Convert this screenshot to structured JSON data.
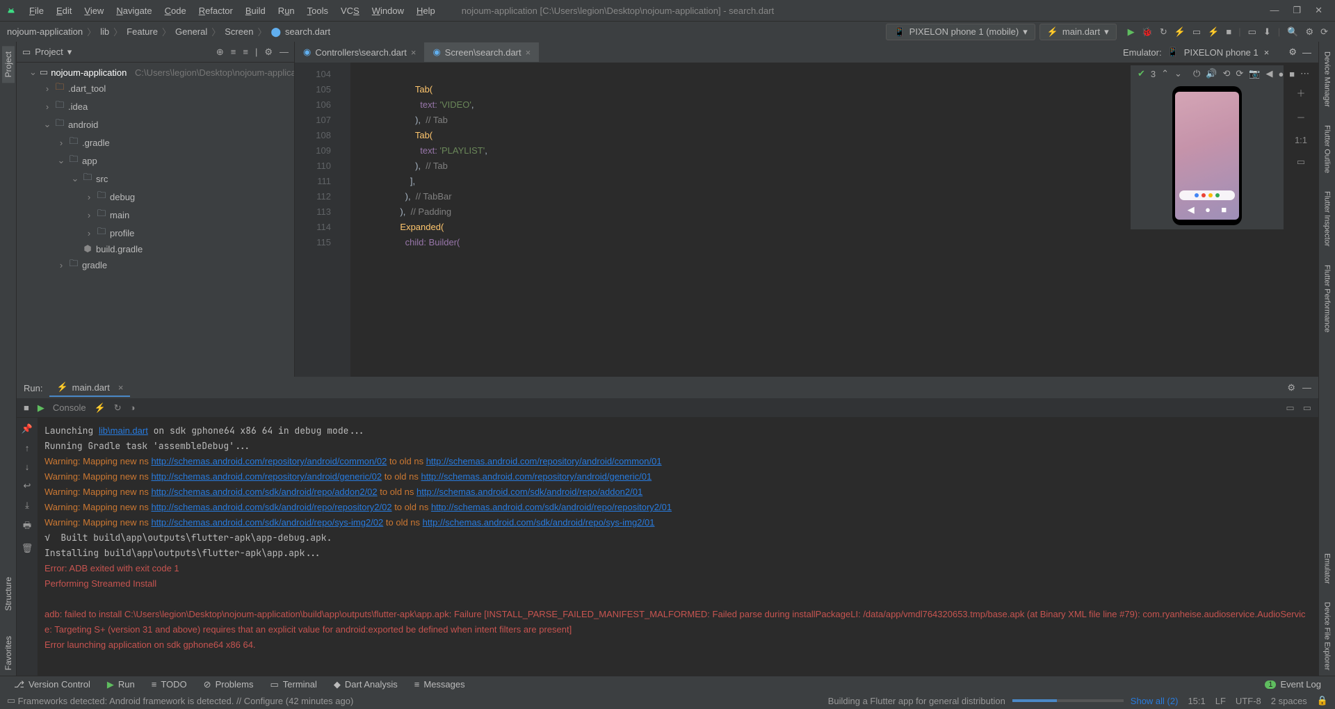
{
  "menu": {
    "file": "File",
    "edit": "Edit",
    "view": "View",
    "navigate": "Navigate",
    "code": "Code",
    "refactor": "Refactor",
    "build": "Build",
    "run": "Run",
    "tools": "Tools",
    "vcs": "VCS",
    "window": "Window",
    "help": "Help"
  },
  "window_title": "nojoum-application [C:\\Users\\legion\\Desktop\\nojoum-application] - search.dart",
  "breadcrumb": [
    "nojoum-application",
    "lib",
    "Feature",
    "General",
    "Screen",
    "search.dart"
  ],
  "device_combo": "PIXELON phone 1 (mobile)",
  "config_combo": "main.dart",
  "left_tools": {
    "project": "Project",
    "structure": "Structure",
    "favorites": "Favorites"
  },
  "right_tools": {
    "device_manager": "Device Manager",
    "flutter_outline": "Flutter Outline",
    "flutter_inspector": "Flutter Inspector",
    "flutter_performance": "Flutter Performance",
    "emulator": "Emulator",
    "device_file": "Device File Explorer"
  },
  "project_panel": {
    "title": "Project"
  },
  "tree": {
    "root": {
      "name": "nojoum-application",
      "path": "C:\\Users\\legion\\Desktop\\nojoum-applicat..."
    },
    "items": [
      {
        "d": 1,
        "exp": ">",
        "icon": "folder-o",
        "name": ".dart_tool"
      },
      {
        "d": 1,
        "exp": ">",
        "icon": "folder",
        "name": ".idea"
      },
      {
        "d": 1,
        "exp": "v",
        "icon": "folder",
        "name": "android"
      },
      {
        "d": 2,
        "exp": ">",
        "icon": "folder",
        "name": ".gradle"
      },
      {
        "d": 2,
        "exp": "v",
        "icon": "folder",
        "name": "app"
      },
      {
        "d": 3,
        "exp": "v",
        "icon": "folder",
        "name": "src"
      },
      {
        "d": 4,
        "exp": ">",
        "icon": "folder",
        "name": "debug"
      },
      {
        "d": 4,
        "exp": ">",
        "icon": "folder",
        "name": "main"
      },
      {
        "d": 4,
        "exp": ">",
        "icon": "folder",
        "name": "profile"
      },
      {
        "d": 3,
        "exp": " ",
        "icon": "gradle",
        "name": "build.gradle"
      },
      {
        "d": 2,
        "exp": ">",
        "icon": "folder",
        "name": "gradle"
      }
    ]
  },
  "editor_tabs": [
    {
      "name": "Controllers\\search.dart",
      "active": false
    },
    {
      "name": "Screen\\search.dart",
      "active": true
    }
  ],
  "emulator_label": "Emulator:",
  "emulator_device": "PIXELON phone 1",
  "emu_problems": "3",
  "code_lines": [
    104,
    105,
    106,
    107,
    108,
    109,
    110,
    111,
    112,
    113,
    114,
    115
  ],
  "code": {
    "l105": "Tab(",
    "l106": "text: ",
    "l106s": "'VIDEO'",
    "l106c": ",",
    "l107": "),  ",
    "l107c": "// Tab",
    "l108": "Tab(",
    "l109": "text: ",
    "l109s": "'PLAYLIST'",
    "l109c": ",",
    "l110": "),  ",
    "l110c": "// Tab",
    "l111": "],",
    "l112": "),  ",
    "l112c": "// TabBar",
    "l113": "),  ",
    "l113c": "// Padding",
    "l114": "Expanded(",
    "l115": "child: Builder("
  },
  "run": {
    "label": "Run:",
    "tab": "main.dart",
    "console_tab": "Console"
  },
  "console": [
    {
      "t": "plain",
      "text": "Launching "
    },
    {
      "t": "link",
      "text": "lib\\main.dart"
    },
    {
      "t": "plain",
      "text": " on sdk gphone64 x86 64 in debug mode...\n"
    },
    {
      "t": "plain",
      "text": "Running Gradle task 'assembleDebug'...\n"
    },
    {
      "t": "warn",
      "text": "Warning: Mapping new ns "
    },
    {
      "t": "link",
      "text": "http://schemas.android.com/repository/android/common/02"
    },
    {
      "t": "warn",
      "text": " to old ns "
    },
    {
      "t": "link",
      "text": "http://schemas.android.com/repository/android/common/01"
    },
    {
      "t": "plain",
      "text": "\n"
    },
    {
      "t": "warn",
      "text": "Warning: Mapping new ns "
    },
    {
      "t": "link",
      "text": "http://schemas.android.com/repository/android/generic/02"
    },
    {
      "t": "warn",
      "text": " to old ns "
    },
    {
      "t": "link",
      "text": "http://schemas.android.com/repository/android/generic/01"
    },
    {
      "t": "plain",
      "text": "\n"
    },
    {
      "t": "warn",
      "text": "Warning: Mapping new ns "
    },
    {
      "t": "link",
      "text": "http://schemas.android.com/sdk/android/repo/addon2/02"
    },
    {
      "t": "warn",
      "text": " to old ns "
    },
    {
      "t": "link",
      "text": "http://schemas.android.com/sdk/android/repo/addon2/01"
    },
    {
      "t": "plain",
      "text": "\n"
    },
    {
      "t": "warn",
      "text": "Warning: Mapping new ns "
    },
    {
      "t": "link",
      "text": "http://schemas.android.com/sdk/android/repo/repository2/02"
    },
    {
      "t": "warn",
      "text": " to old ns "
    },
    {
      "t": "link",
      "text": "http://schemas.android.com/sdk/android/repo/repository2/01"
    },
    {
      "t": "plain",
      "text": "\n"
    },
    {
      "t": "warn",
      "text": "Warning: Mapping new ns "
    },
    {
      "t": "link",
      "text": "http://schemas.android.com/sdk/android/repo/sys-img2/02"
    },
    {
      "t": "warn",
      "text": " to old ns "
    },
    {
      "t": "link",
      "text": "http://schemas.android.com/sdk/android/repo/sys-img2/01"
    },
    {
      "t": "plain",
      "text": "\n"
    },
    {
      "t": "plain",
      "text": "√  Built build\\app\\outputs\\flutter-apk\\app-debug.apk.\n"
    },
    {
      "t": "plain",
      "text": "Installing build\\app\\outputs\\flutter-apk\\app.apk...\n"
    },
    {
      "t": "err",
      "text": "Error: ADB exited with exit code 1\n"
    },
    {
      "t": "err",
      "text": "Performing Streamed Install\n"
    },
    {
      "t": "plain",
      "text": "\n"
    },
    {
      "t": "err",
      "text": "adb: failed to install C:\\Users\\legion\\Desktop\\nojoum-application\\build\\app\\outputs\\flutter-apk\\app.apk: Failure [INSTALL_PARSE_FAILED_MANIFEST_MALFORMED: Failed parse during installPackageLI: /data/app/vmdl764320653.tmp/base.apk (at Binary XML file line #79): com.ryanheise.audioservice.AudioService: Targeting S+ (version 31 and above) requires that an explicit value for android:exported be defined when intent filters are present]\n"
    },
    {
      "t": "err",
      "text": "Error launching application on sdk gphone64 x86 64.\n"
    }
  ],
  "bottom": {
    "vc": "Version Control",
    "run": "Run",
    "todo": "TODO",
    "problems": "Problems",
    "terminal": "Terminal",
    "dart": "Dart Analysis",
    "messages": "Messages",
    "event": "Event Log",
    "event_count": "1"
  },
  "status": {
    "msg": "Frameworks detected: Android framework is detected. // Configure (42 minutes ago)",
    "task": "Building a Flutter app for general distribution",
    "showall": "Show all (2)",
    "pos": "15:1",
    "lf": "LF",
    "enc": "UTF-8",
    "indent": "2 spaces"
  }
}
